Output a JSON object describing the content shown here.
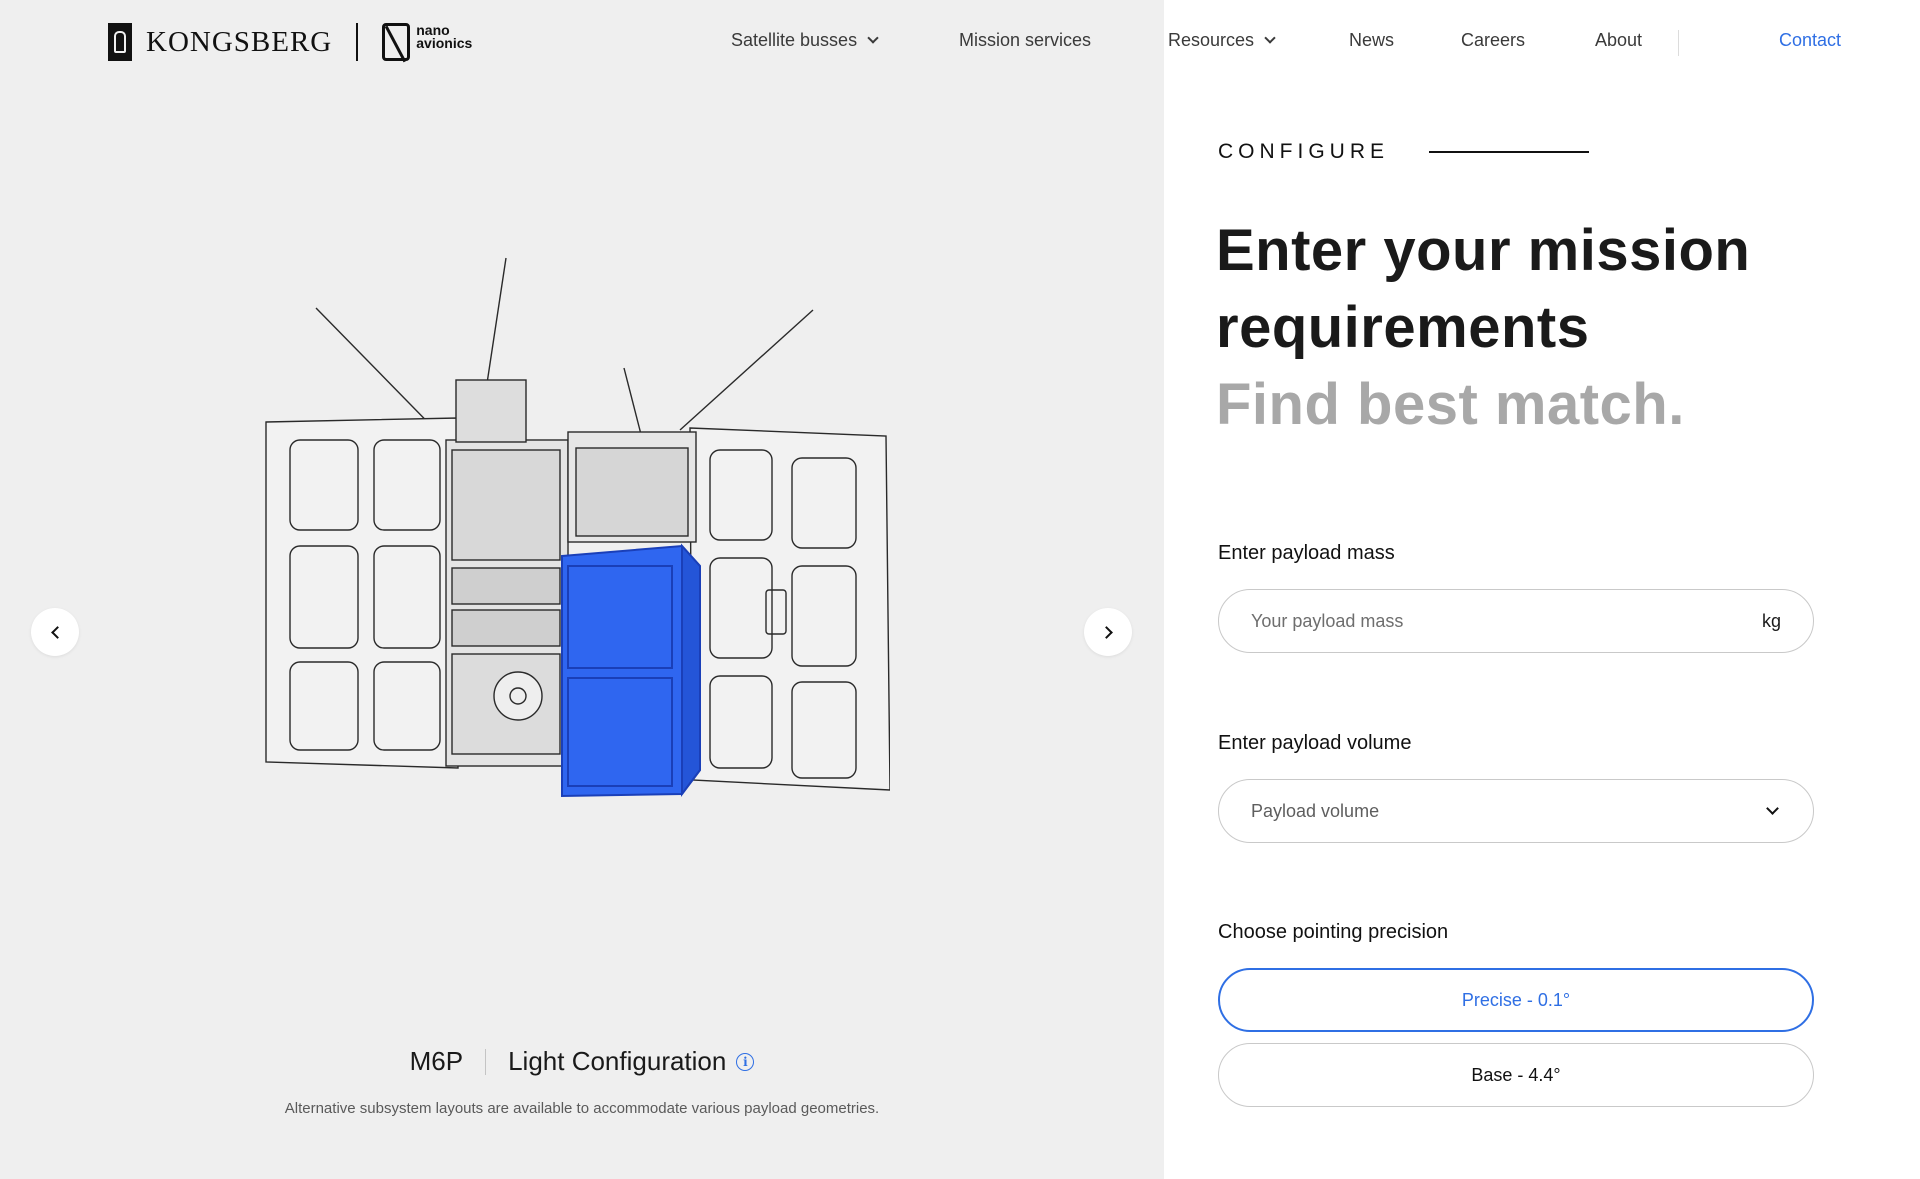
{
  "brand": {
    "kongsberg": "KONGSBERG",
    "nano_line1": "nano",
    "nano_line2": "avionics"
  },
  "nav": {
    "items": [
      {
        "label": "Satellite busses",
        "has_dropdown": true
      },
      {
        "label": "Mission services",
        "has_dropdown": false
      },
      {
        "label": "Resources",
        "has_dropdown": true
      },
      {
        "label": "News",
        "has_dropdown": false
      },
      {
        "label": "Careers",
        "has_dropdown": false
      },
      {
        "label": "About",
        "has_dropdown": false
      }
    ],
    "contact": "Contact"
  },
  "carousel": {
    "model": "M6P",
    "configuration": "Light Configuration",
    "caption": "Alternative subsystem layouts are available to accommodate various payload geometries.",
    "prev_icon": "chevron-left-icon",
    "next_icon": "chevron-right-icon"
  },
  "form": {
    "section_label": "CONFIGURE",
    "heading_line1": "Enter your mission",
    "heading_line2": "requirements",
    "heading_sub": "Find best match.",
    "mass": {
      "label": "Enter payload mass",
      "placeholder": "Your payload mass",
      "unit": "kg"
    },
    "volume": {
      "label": "Enter payload volume",
      "placeholder": "Payload volume"
    },
    "pointing": {
      "label": "Choose pointing precision",
      "options": [
        {
          "label": "Precise - 0.1°",
          "selected": true
        },
        {
          "label": "Base - 4.4°",
          "selected": false
        }
      ]
    }
  },
  "colors": {
    "accent": "#2f6fe4",
    "left_bg": "#efefef",
    "payload_blue": "#2f66f0"
  }
}
